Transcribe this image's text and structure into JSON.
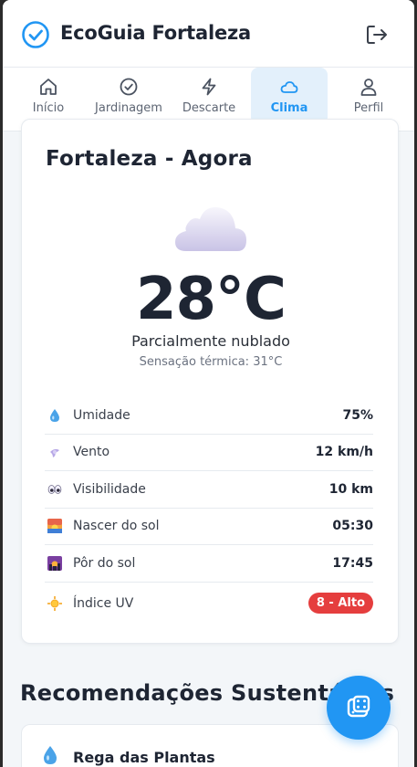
{
  "header": {
    "app_title": "EcoGuia Fortaleza",
    "logo_icon": "check-circle-icon",
    "logout_icon": "logout-icon"
  },
  "tabs": [
    {
      "label": "Início",
      "icon": "home-icon",
      "active": false
    },
    {
      "label": "Jardinagem",
      "icon": "check-circle-icon",
      "active": false
    },
    {
      "label": "Descarte",
      "icon": "lightning-icon",
      "active": false
    },
    {
      "label": "Clima",
      "icon": "cloud-icon",
      "active": true
    },
    {
      "label": "Perfil",
      "icon": "user-icon",
      "active": false
    }
  ],
  "weather": {
    "title": "Fortaleza - Agora",
    "icon": "cloud-icon",
    "temperature": "28°C",
    "condition": "Parcialmente nublado",
    "feels_like": "Sensação térmica: 31°C",
    "details": [
      {
        "icon": "droplet-icon",
        "label": "Umidade",
        "value": "75%"
      },
      {
        "icon": "wind-icon",
        "label": "Vento",
        "value": "12 km/h"
      },
      {
        "icon": "eyes-icon",
        "label": "Visibilidade",
        "value": "10 km"
      },
      {
        "icon": "sunrise-icon",
        "label": "Nascer do sol",
        "value": "05:30"
      },
      {
        "icon": "sunset-icon",
        "label": "Pôr do sol",
        "value": "17:45"
      },
      {
        "icon": "sun-icon",
        "label": "Índice UV",
        "value": "8 - Alto"
      }
    ]
  },
  "recommendations": {
    "title": "Recomendações Sustentáveis",
    "items": [
      {
        "icon": "droplet-icon",
        "title": "Rega das Plantas"
      }
    ]
  },
  "fab": {
    "icon": "chat-dice-icon"
  },
  "colors": {
    "accent": "#2196f3",
    "uv_high": "#e53e3e",
    "text_dark": "#1e2533"
  }
}
